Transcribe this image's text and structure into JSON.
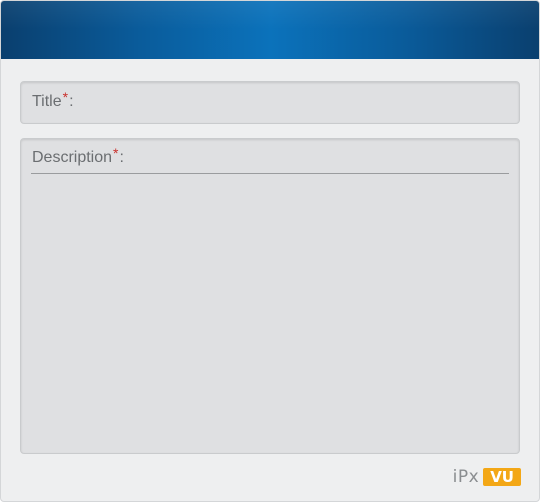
{
  "form": {
    "title_field": {
      "label": "Title",
      "required_mark": "*",
      "colon": ":",
      "value": ""
    },
    "description_field": {
      "label": "Description",
      "required_mark": "*",
      "colon": ":",
      "value": ""
    }
  },
  "branding": {
    "logo_text": "iPx",
    "logo_badge": "VU",
    "badge_color": "#f3a716"
  },
  "colors": {
    "header_blue": "#0b72bb",
    "required_star": "#c9302c"
  }
}
